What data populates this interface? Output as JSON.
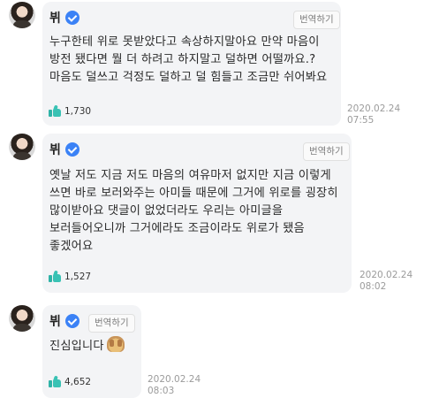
{
  "messages": [
    {
      "author": "뷔",
      "translate_label": "번역하기",
      "lines": [
        "누구한테 위로 못받았다고 속상하지말아요 만약 마음이",
        "방전 됐다면 뭘 더 하려고 하지말고 덜하면 어떨까요.?",
        "마음도 덜쓰고 걱정도 덜하고 덜 힘들고 조금만 쉬어봐요"
      ],
      "likes": "1,730",
      "date": "2020.02.24",
      "time": "07:55"
    },
    {
      "author": "뷔",
      "translate_label": "번역하기",
      "lines": [
        "옛날 저도 지금 저도 마음의 여유마저 없지만 지금 이렇게",
        "쓰면 바로 보러와주는 아미들 때문에 그거에 위로를 굉장히",
        "많이받아요 댓글이 없었더라도 우리는 아미글을",
        "보러들어오니까 그거에라도 조금이라도 위로가 됐음",
        "좋겠어요"
      ],
      "likes": "1,527",
      "date": "2020.02.24",
      "time": "08:02"
    },
    {
      "author": "뷔",
      "translate_label": "번역하기",
      "lines": [
        "진심입니다"
      ],
      "emoji": "hands-covering-face-emoji",
      "likes": "4,652",
      "date": "2020.02.24",
      "time": "08:03"
    }
  ],
  "icons": {
    "verified": "verified-badge-icon",
    "like": "thumbs-up-icon"
  },
  "colors": {
    "verified": "#3b82f6",
    "like": "#39c2b4",
    "bubble": "#f3f4f6"
  }
}
